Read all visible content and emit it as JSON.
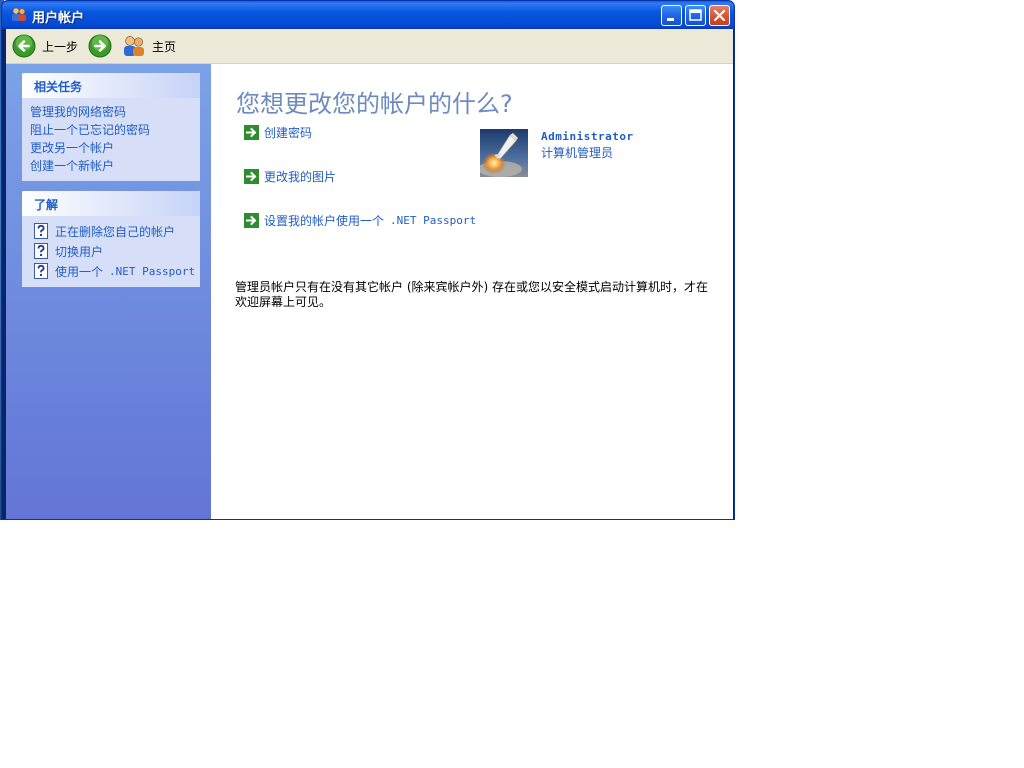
{
  "window": {
    "title": "用户帐户"
  },
  "toolbar": {
    "back_label": "上一步",
    "home_label": "主页"
  },
  "sidebar": {
    "related_tasks": {
      "header": "相关任务",
      "items": [
        {
          "label": "管理我的网络密码"
        },
        {
          "label": "阻止一个已忘记的密码"
        },
        {
          "label": "更改另一个帐户"
        },
        {
          "label": "创建一个新帐户"
        }
      ]
    },
    "learn_about": {
      "header": "了解",
      "items": [
        {
          "label": "正在删除您自己的帐户"
        },
        {
          "label": "切换用户"
        },
        {
          "label": "使用一个",
          "label_suffix": ".NET Passport"
        }
      ]
    }
  },
  "main": {
    "title": "您想更改您的帐户的什么?",
    "options": [
      {
        "label": "创建密码"
      },
      {
        "label": "更改我的图片"
      },
      {
        "label": "设置我的帐户使用一个",
        "label_suffix": ".NET Passport"
      }
    ],
    "account": {
      "name": "Administrator",
      "role": "计算机管理员"
    },
    "note": "管理员帐户只有在没有其它帐户 (除来宾帐户外) 存在或您以安全模式启动计算机时，才在欢迎屏幕上可见。"
  },
  "icons": {
    "title_icon": "users-icon",
    "back": "back-arrow-icon",
    "forward": "forward-arrow-icon",
    "home": "users-home-icon",
    "help": "question-icon",
    "option": "green-arrow-icon",
    "avatar": "space-shuttle-picture"
  },
  "colors": {
    "link": "#215dc6",
    "title": "#6d8bbf",
    "titlebar": "#0a5df0",
    "taskpane": "#6d8ce0"
  }
}
